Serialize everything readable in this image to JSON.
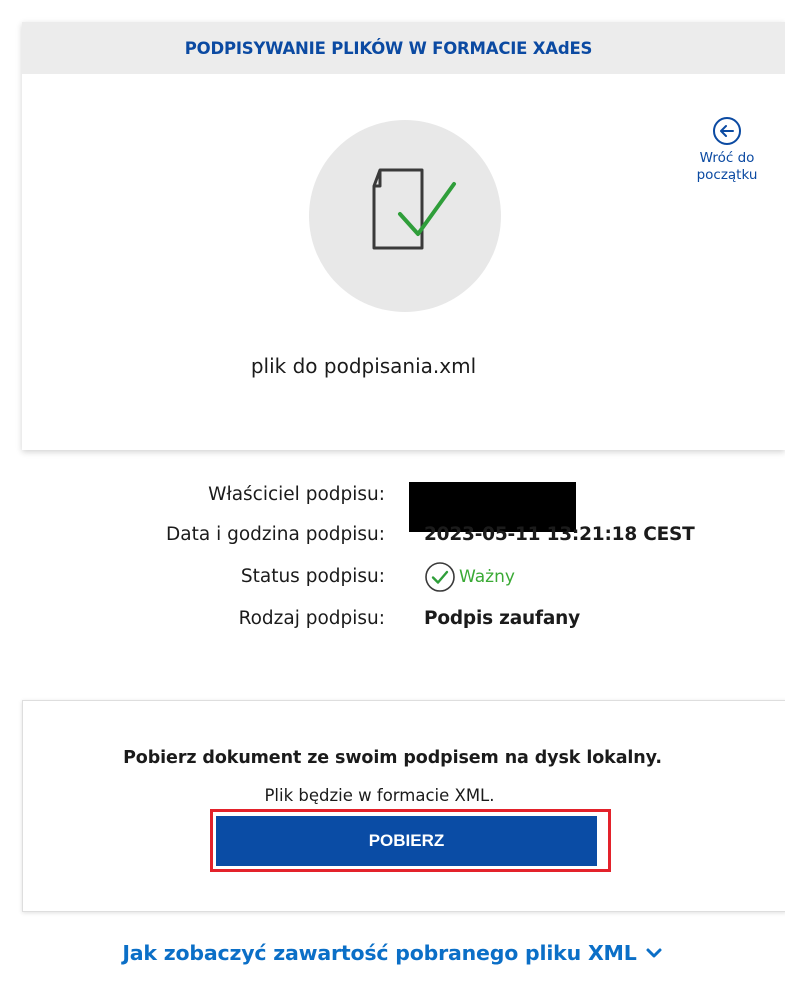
{
  "header": {
    "title": "PODPISYWANIE PLIKÓW W FORMACIE XAdES"
  },
  "back_link": {
    "label": "Wróć do\npoczątku"
  },
  "file": {
    "name": "plik do podpisania.xml"
  },
  "signature_details": {
    "owner_label": "Właściciel podpisu:",
    "datetime_label": "Data i godzina podpisu:",
    "datetime_value": "2023-05-11 13:21:18 CEST",
    "status_label": "Status podpisu:",
    "status_value": "Ważny",
    "type_label": "Rodzaj podpisu:",
    "type_value": "Podpis zaufany"
  },
  "download": {
    "heading": "Pobierz dokument ze swoim podpisem na dysk lokalny.",
    "subtext": "Plik będzie w formacie XML.",
    "button_label": "POBIERZ"
  },
  "howto": {
    "label": "Jak zobaczyć zawartość pobranego pliku XML"
  },
  "colors": {
    "brand_blue": "#0a4ca5",
    "link_blue": "#0b6fc7",
    "valid_green": "#3aaa35",
    "highlight_red": "#e3222b"
  }
}
